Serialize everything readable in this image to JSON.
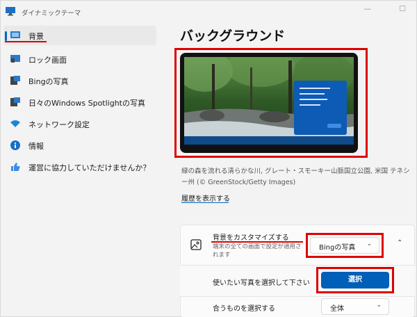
{
  "window": {
    "title": "ダイナミックテーマ",
    "minimize": "—",
    "maximize": "☐"
  },
  "sidebar": {
    "items": [
      {
        "label": "背景",
        "icon": "monitor-icon",
        "active": true
      },
      {
        "label": "ロック画面",
        "icon": "lock-screen-icon"
      },
      {
        "label": "Bingの写真",
        "icon": "bing-photo-icon"
      },
      {
        "label": "日々のWindows Spotlightの写真",
        "icon": "spotlight-photo-icon"
      },
      {
        "label": "ネットワーク設定",
        "icon": "wifi-icon"
      },
      {
        "label": "情報",
        "icon": "info-icon"
      },
      {
        "label": "運営に協力していただけませんか？",
        "icon": "thumbs-up-icon"
      }
    ]
  },
  "main": {
    "title": "バックグラウンド",
    "caption": "緑の森を流れる清らかな川, グレート・スモーキー山脈国立公園, 米国 テネシー州 (© GreenStock/Getty Images)",
    "history_link": "履歴を表示する",
    "customize": {
      "title": "背景をカスタマイズする",
      "subtitle": "端末の全ての画面で設定が適用されます",
      "dropdown_value": "Bingの写真"
    },
    "select_row": {
      "label": "使いたい写真を選択して下さい",
      "button": "選択"
    },
    "fit_row": {
      "label": "合うものを選択する",
      "dropdown_value": "全体"
    }
  },
  "colors": {
    "accent": "#005fb8",
    "highlight": "#e00000"
  }
}
